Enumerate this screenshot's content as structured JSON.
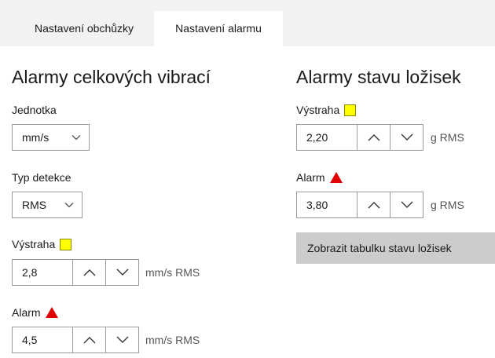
{
  "tabs": [
    {
      "label": "Nastavení obchůzky"
    },
    {
      "label": "Nastavení alarmu"
    }
  ],
  "overall": {
    "title": "Alarmy celkových vibrací",
    "unit_label": "Jednotka",
    "unit_value": "mm/s",
    "detection_label": "Typ detekce",
    "detection_value": "RMS",
    "warning_label": "Výstraha",
    "warning_value": "2,8",
    "warning_unit": "mm/s RMS",
    "alarm_label": "Alarm",
    "alarm_value": "4,5",
    "alarm_unit": "mm/s RMS"
  },
  "bearing": {
    "title": "Alarmy stavu ložisek",
    "warning_label": "Výstraha",
    "warning_value": "2,20",
    "warning_unit": "g RMS",
    "alarm_label": "Alarm",
    "alarm_value": "3,80",
    "alarm_unit": "g RMS",
    "button_label": "Zobrazit tabulku stavu ložisek"
  },
  "colors": {
    "warning": "#ffff00",
    "alarm": "#e00000",
    "tabbar": "#f2f2f2",
    "button": "#cccccc"
  }
}
